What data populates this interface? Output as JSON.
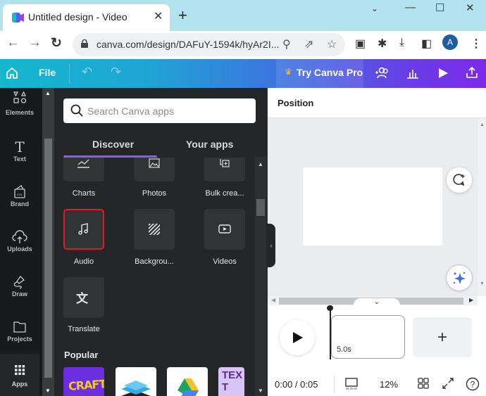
{
  "browser": {
    "tab_title": "Untitled design - Video",
    "new_tab_label": "+",
    "url": "canva.com/design/DAFuY-1594k/hyAr2I...",
    "profile_initial": "A",
    "window_controls": [
      "chevron-down",
      "minimize",
      "maximize",
      "close"
    ]
  },
  "header": {
    "file_label": "File",
    "try_pro_label": "Try Canva Pro",
    "colors": {
      "gradient_start": "#14b7cd",
      "gradient_end": "#7d2ae8",
      "crown": "#f7b62c"
    }
  },
  "sidebar": {
    "items": [
      {
        "label": "Elements",
        "icon": "shapes-icon"
      },
      {
        "label": "Text",
        "icon": "text-icon"
      },
      {
        "label": "Brand",
        "icon": "brand-icon"
      },
      {
        "label": "Uploads",
        "icon": "upload-cloud-icon"
      },
      {
        "label": "Draw",
        "icon": "draw-icon"
      },
      {
        "label": "Projects",
        "icon": "folder-icon"
      },
      {
        "label": "Apps",
        "icon": "apps-grid-icon",
        "active": true
      }
    ]
  },
  "apps_panel": {
    "search_placeholder": "Search Canva apps",
    "tabs": [
      {
        "label": "Discover",
        "active": true
      },
      {
        "label": "Your apps",
        "active": false
      }
    ],
    "apps": [
      {
        "label": "Charts",
        "icon": "chart-icon"
      },
      {
        "label": "Photos",
        "icon": "photo-icon"
      },
      {
        "label": "Bulk crea...",
        "icon": "bulk-create-icon"
      },
      {
        "label": "Audio",
        "icon": "music-note-icon",
        "selected": true
      },
      {
        "label": "Backgrou...",
        "icon": "background-pattern-icon"
      },
      {
        "label": "Videos",
        "icon": "video-icon"
      },
      {
        "label": "Translate",
        "icon": "translate-icon"
      }
    ],
    "popular_heading": "Popular",
    "popular_apps": [
      {
        "name": "craft-app",
        "text": "CRAFT"
      },
      {
        "name": "layers-app",
        "text": ""
      },
      {
        "name": "google-drive-app",
        "text": ""
      },
      {
        "name": "text-app",
        "text": "TEXT"
      }
    ],
    "accent_color": "#8b5cf6",
    "selected_border_color": "#e01b24"
  },
  "editor": {
    "position_label": "Position",
    "timeline": {
      "clip_duration": "5.0s",
      "add_label": "+"
    },
    "footer": {
      "time": "0:00 / 0:05",
      "zoom": "12%"
    }
  }
}
